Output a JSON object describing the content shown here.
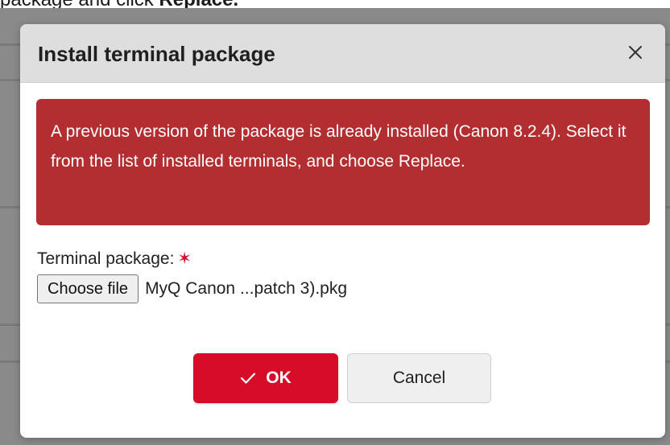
{
  "background": {
    "instruction_text_pre": "package and click ",
    "instruction_text_bold": "Replace."
  },
  "dialog": {
    "title": "Install terminal package",
    "close_icon": "close-icon",
    "alert": {
      "text": "A previous version of the package is already installed (Canon 8.2.4). Select it from the list of installed terminals, and choose Replace.",
      "color": "#b22e31"
    },
    "field": {
      "label": "Terminal package:",
      "required_marker": "✶",
      "choose_file_label": "Choose file",
      "file_name": "MyQ Canon ...patch 3).pkg"
    },
    "buttons": {
      "ok_label": "OK",
      "ok_icon": "checkmark-icon",
      "cancel_label": "Cancel"
    },
    "colors": {
      "primary": "#d70c29",
      "header_bg": "#dedede"
    }
  }
}
